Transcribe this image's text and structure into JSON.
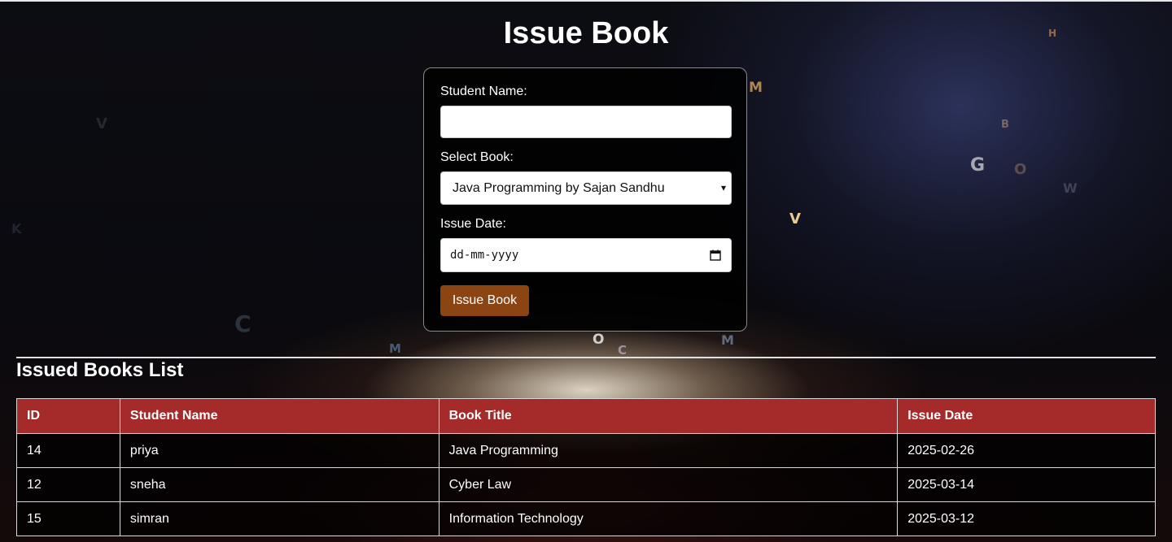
{
  "page": {
    "title": "Issue Book"
  },
  "form": {
    "student_name_label": "Student Name:",
    "student_name_value": "",
    "select_book_label": "Select Book:",
    "selected_book": "Java Programming by Sajan Sandhu",
    "issue_date_label": "Issue Date:",
    "issue_date_placeholder": "dd-mm-yyyy",
    "submit_label": "Issue Book"
  },
  "issued_list": {
    "title": "Issued Books List",
    "columns": [
      "ID",
      "Student Name",
      "Book Title",
      "Issue Date"
    ],
    "rows": [
      [
        "14",
        "priya",
        "Java Programming",
        "2025-02-26"
      ],
      [
        "12",
        "sneha",
        "Cyber Law",
        "2025-03-14"
      ],
      [
        "15",
        "simran",
        "Information Technology",
        "2025-03-12"
      ]
    ]
  },
  "colors": {
    "button": "#8b4513",
    "table_header": "#a52a2a"
  },
  "icons": {
    "select": "chevron-down-icon",
    "date": "calendar-icon"
  },
  "background_letters": [
    "M",
    "V",
    "G",
    "O",
    "W",
    "M",
    "O",
    "C",
    "M",
    "C",
    "H",
    "V",
    "K",
    "B"
  ]
}
